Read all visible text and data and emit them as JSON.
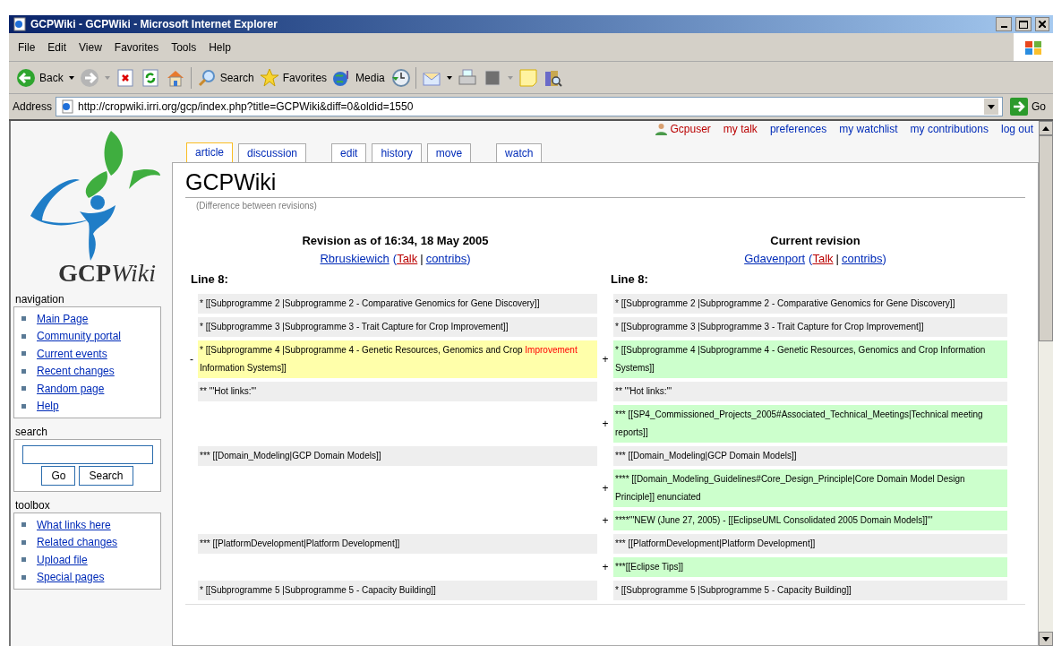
{
  "window": {
    "title": "GCPWiki - GCPWiki - Microsoft Internet Explorer"
  },
  "menu": [
    "File",
    "Edit",
    "View",
    "Favorites",
    "Tools",
    "Help"
  ],
  "toolbar": [
    {
      "kind": "back",
      "label": "Back"
    },
    {
      "kind": "forward"
    },
    {
      "kind": "stop"
    },
    {
      "kind": "refresh"
    },
    {
      "kind": "home"
    },
    {
      "kind": "search",
      "label": "Search"
    },
    {
      "kind": "favorites",
      "label": "Favorites"
    },
    {
      "kind": "media",
      "label": "Media"
    },
    {
      "kind": "history"
    },
    {
      "kind": "mail"
    },
    {
      "kind": "print"
    },
    {
      "kind": "edit"
    },
    {
      "kind": "note"
    },
    {
      "kind": "research"
    }
  ],
  "address": {
    "label": "Address",
    "value": "http://cropwiki.irri.org/gcp/index.php?title=GCPWiki&diff=0&oldid=1550",
    "go": "Go"
  },
  "user_links": [
    {
      "label": "Gcpuser",
      "kind": "user"
    },
    {
      "label": "my talk",
      "kind": "new"
    },
    {
      "label": "preferences",
      "kind": "link"
    },
    {
      "label": "my watchlist",
      "kind": "link"
    },
    {
      "label": "my contributions",
      "kind": "link"
    },
    {
      "label": "log out",
      "kind": "link"
    }
  ],
  "tabs": [
    {
      "label": "article",
      "selected": true
    },
    {
      "label": "discussion",
      "selected": false
    },
    {
      "label": "edit",
      "selected": false
    },
    {
      "label": "history",
      "selected": false
    },
    {
      "label": "move",
      "selected": false
    },
    {
      "label": "watch",
      "selected": false
    }
  ],
  "logo": {
    "text": "GCP",
    "italic": "Wiki"
  },
  "sidebar": [
    {
      "title": "navigation",
      "kind": "links",
      "items": [
        "Main Page",
        "Community portal",
        "Current events",
        "Recent changes",
        "Random page",
        "Help"
      ]
    },
    {
      "title": "search",
      "kind": "search",
      "buttons": [
        "Go",
        "Search"
      ]
    },
    {
      "title": "toolbox",
      "kind": "links",
      "items": [
        "What links here",
        "Related changes",
        "Upload file",
        "Special pages"
      ]
    }
  ],
  "page": {
    "title": "GCPWiki",
    "subtitle": "(Difference between revisions)"
  },
  "diff": {
    "left": {
      "heading": "Revision as of 16:34, 18 May 2005",
      "user": "Rbruskiewich",
      "open": "(",
      "talk": "Talk",
      "separator": "|",
      "contribs": "contribs",
      "close": ")",
      "line": "Line 8:"
    },
    "right": {
      "heading": "Current revision",
      "user": "Gdavenport",
      "open": "(",
      "talk": "Talk",
      "separator": "|",
      "contribs": "contribs",
      "close": ")",
      "line": "Line 8:"
    },
    "rows": [
      {
        "kind": "context",
        "left": [
          {
            "text": "* [[Subprogramme 2 |Subprogramme 2 - Comparative Genomics for Gene Discovery]]",
            "changed": false
          }
        ],
        "right": "* [[Subprogramme 2 |Subprogramme 2 - Comparative Genomics for Gene Discovery]]"
      },
      {
        "kind": "context",
        "left": [
          {
            "text": "* [[Subprogramme 3 |Subprogramme 3 - Trait Capture for Crop Improvement]]",
            "changed": false
          }
        ],
        "right": "* [[Subprogramme 3 |Subprogramme 3 - Trait Capture for Crop Improvement]]"
      },
      {
        "kind": "change",
        "left_marker": "-",
        "right_marker": "+",
        "left": [
          {
            "text": "* [[Subprogramme 4 |Subprogramme 4 - Genetic Resources, Genomics and Crop ",
            "changed": false
          },
          {
            "text": "Improvement",
            "changed": true
          },
          {
            "text": " Information Systems]]",
            "changed": false
          }
        ],
        "right": "* [[Subprogramme 4 |Subprogramme 4 - Genetic Resources, Genomics and Crop Information Systems]]"
      },
      {
        "kind": "context",
        "left": [
          {
            "text": "** '''Hot links:'''",
            "changed": false
          }
        ],
        "right": "** '''Hot links:'''"
      },
      {
        "kind": "add",
        "right_marker": "+",
        "right": "*** [[SP4_Commissioned_Projects_2005#Associated_Technical_Meetings|Technical meeting reports]]"
      },
      {
        "kind": "context",
        "left": [
          {
            "text": "*** [[Domain_Modeling|GCP Domain Models]]",
            "changed": false
          }
        ],
        "right": "*** [[Domain_Modeling|GCP Domain Models]]"
      },
      {
        "kind": "add",
        "right_marker": "+",
        "right": "**** [[Domain_Modeling_Guidelines#Core_Design_Principle|Core Domain Model Design Principle]] enunciated"
      },
      {
        "kind": "add",
        "right_marker": "+",
        "right": "****'''NEW (June 27, 2005) - [[EclipseUML Consolidated 2005 Domain Models]]'''"
      },
      {
        "kind": "context",
        "left": [
          {
            "text": "*** [[PlatformDevelopment|Platform Development]]",
            "changed": false
          }
        ],
        "right": "*** [[PlatformDevelopment|Platform Development]]"
      },
      {
        "kind": "add",
        "right_marker": "+",
        "right": "***[[Eclipse Tips]]"
      },
      {
        "kind": "context",
        "left": [
          {
            "text": "* [[Subprogramme 5 |Subprogramme 5 - Capacity Building]]",
            "changed": false
          }
        ],
        "right": "* [[Subprogramme 5 |Subprogramme 5 - Capacity Building]]"
      }
    ]
  }
}
